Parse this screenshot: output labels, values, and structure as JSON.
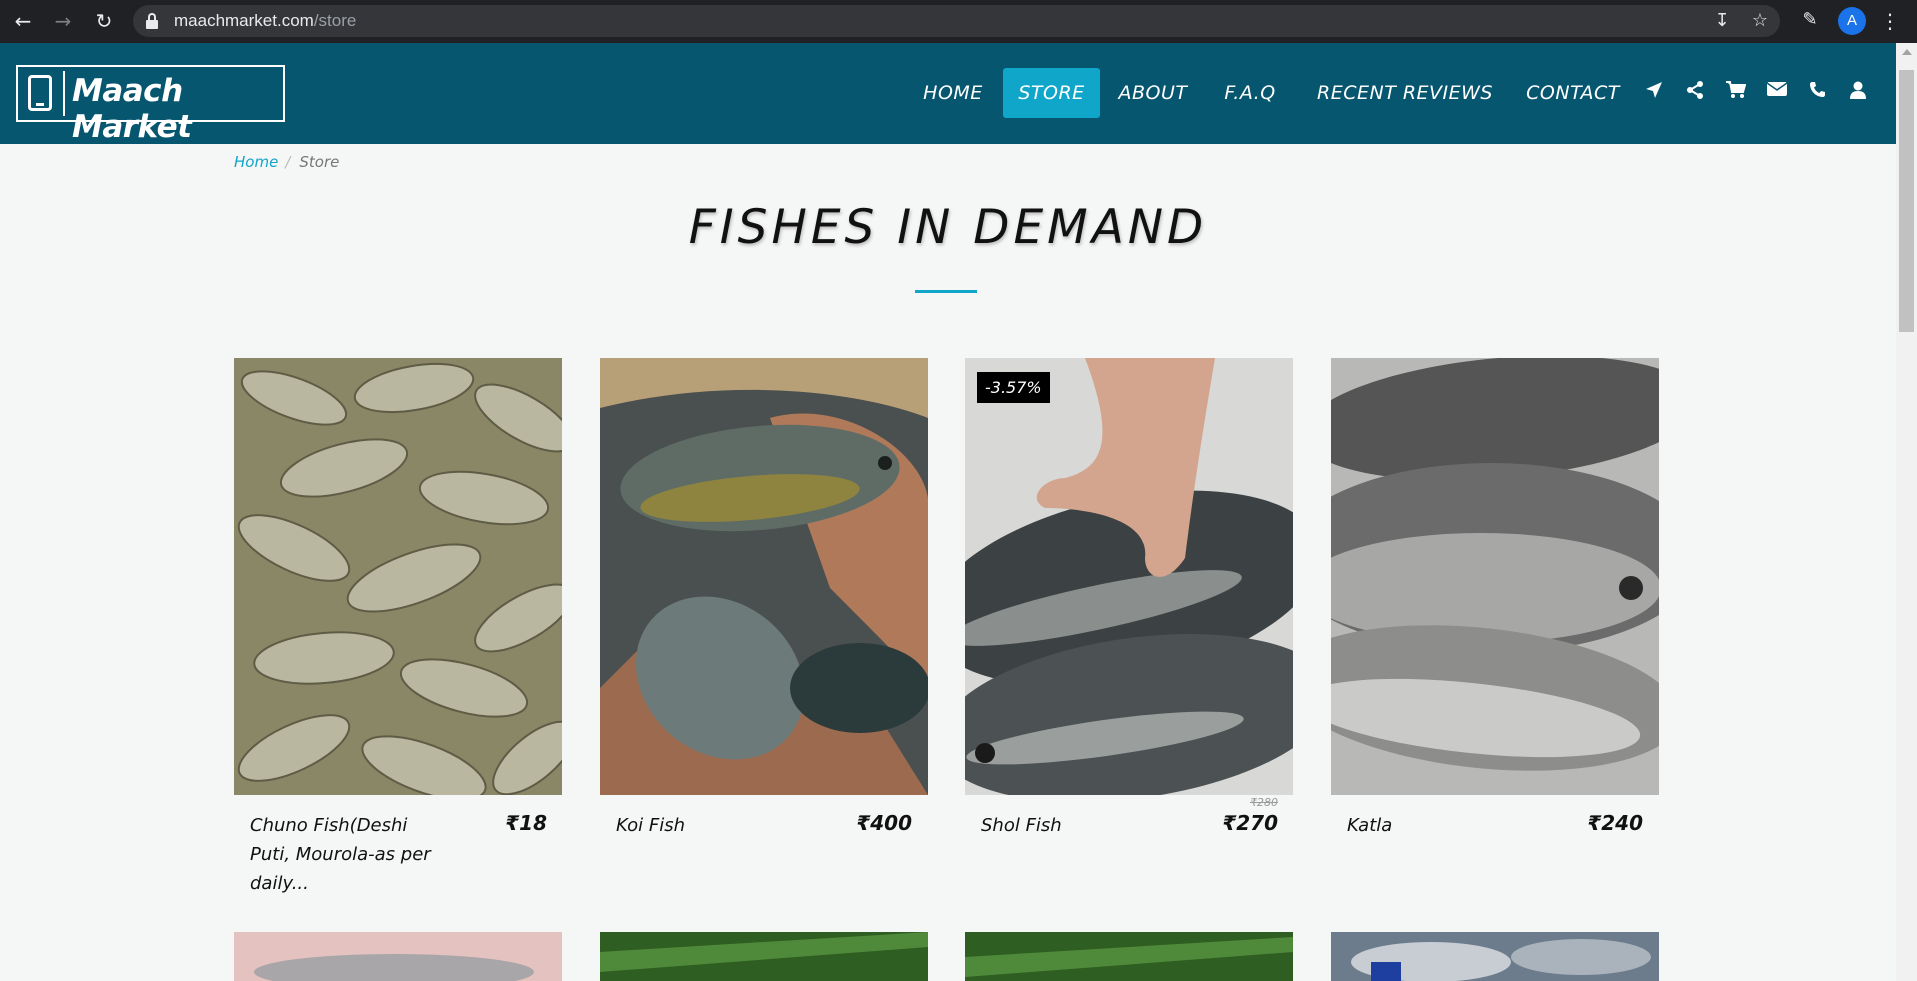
{
  "browser": {
    "url_host": "maachmarket.com",
    "url_path": "/store",
    "avatar_letter": "A"
  },
  "header": {
    "logo_text": "Maach Market",
    "menu": [
      {
        "label": "HOME"
      },
      {
        "label": "STORE",
        "active": true
      },
      {
        "label": "ABOUT"
      },
      {
        "label": "F.A.Q"
      },
      {
        "label": "RECENT REVIEWS"
      },
      {
        "label": "CONTACT"
      }
    ],
    "icons": [
      "location-arrow-icon",
      "share-icon",
      "cart-icon",
      "envelope-icon",
      "phone-icon",
      "user-icon"
    ],
    "accent_color": "#10a6c9",
    "bg_color": "#06566f"
  },
  "breadcrumb": {
    "home": "Home",
    "separator": "/",
    "current": "Store"
  },
  "page_title": "FISHES IN DEMAND",
  "products": [
    {
      "name": "Chuno Fish(Deshi Puti, Mourola-as per daily...",
      "price": "₹18"
    },
    {
      "name": "Koi Fish",
      "price": "₹400"
    },
    {
      "name": "Shol Fish",
      "price": "₹270",
      "old_price": "₹280",
      "badge": "-3.57%"
    },
    {
      "name": "Katla",
      "price": "₹240"
    }
  ]
}
